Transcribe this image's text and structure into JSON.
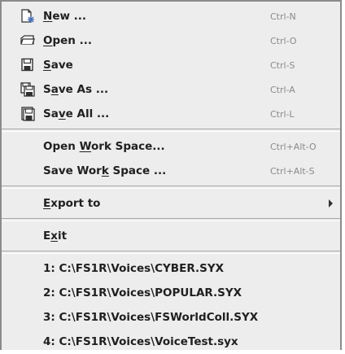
{
  "menu": {
    "new": {
      "pre": "",
      "mnemonic": "N",
      "post": "ew ...",
      "accel": "Ctrl-N",
      "icon": "new-file-icon"
    },
    "open": {
      "pre": "",
      "mnemonic": "O",
      "post": "pen ...",
      "accel": "Ctrl-O",
      "icon": "open-folder-icon"
    },
    "save": {
      "pre": "",
      "mnemonic": "S",
      "post": "ave",
      "accel": "Ctrl-S",
      "icon": "floppy-disk-icon"
    },
    "save_as": {
      "pre": "S",
      "mnemonic": "a",
      "post": "ve As ...",
      "accel": "Ctrl-A",
      "icon": "floppy-disk-save-as-icon"
    },
    "save_all": {
      "pre": "Sa",
      "mnemonic": "v",
      "post": "e All ...",
      "accel": "Ctrl-L",
      "icon": "floppy-disk-save-all-icon"
    },
    "open_workspace": {
      "pre": "Open ",
      "mnemonic": "W",
      "post": "ork Space...",
      "accel": "Ctrl+Alt-O"
    },
    "save_workspace": {
      "pre": "Save Wor",
      "mnemonic": "k",
      "post": " Space ...",
      "accel": "Ctrl+Alt-S"
    },
    "export_to": {
      "pre": "",
      "mnemonic": "E",
      "post": "xport to",
      "icon": "submenu-arrow-icon"
    },
    "exit": {
      "pre": "E",
      "mnemonic": "x",
      "post": "it"
    },
    "recent": [
      "1: C:\\FS1R\\Voices\\CYBER.SYX",
      "2: C:\\FS1R\\Voices\\POPULAR.SYX",
      "3: C:\\FS1R\\Voices\\FSWorldColl.SYX",
      "4: C:\\FS1R\\Voices\\VoiceTest.syx"
    ]
  }
}
